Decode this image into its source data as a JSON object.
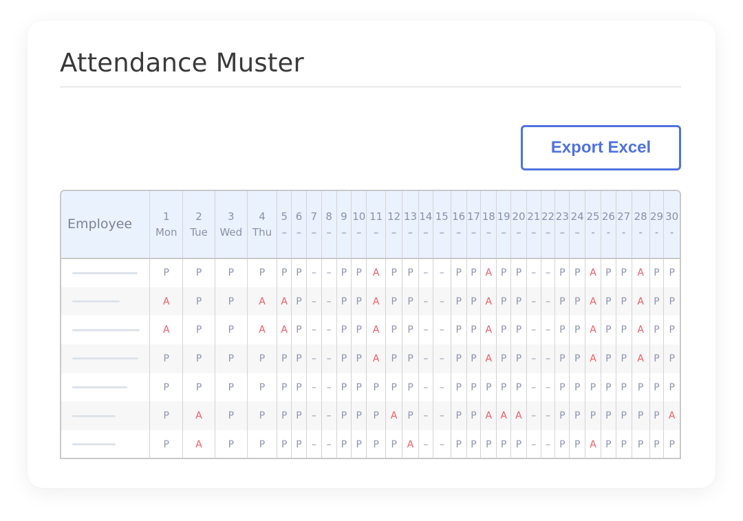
{
  "page": {
    "title": "Attendance Muster",
    "export_button_label": "Export Excel"
  },
  "colors": {
    "accent": "#4f72e0",
    "absent": "#f05a64",
    "present": "#8e94b0",
    "header_bg": "#eaf2fe"
  },
  "table": {
    "employee_header": "Employee",
    "columns": [
      {
        "day": "1",
        "weekday": "Mon"
      },
      {
        "day": "2",
        "weekday": "Tue"
      },
      {
        "day": "3",
        "weekday": "Wed"
      },
      {
        "day": "4",
        "weekday": "Thu"
      },
      {
        "day": "5",
        "weekday": "–"
      },
      {
        "day": "6",
        "weekday": "–"
      },
      {
        "day": "7",
        "weekday": "–"
      },
      {
        "day": "8",
        "weekday": "–"
      },
      {
        "day": "9",
        "weekday": "–"
      },
      {
        "day": "10",
        "weekday": "–"
      },
      {
        "day": "11",
        "weekday": "–"
      },
      {
        "day": "12",
        "weekday": "–"
      },
      {
        "day": "13",
        "weekday": "–"
      },
      {
        "day": "14",
        "weekday": "–"
      },
      {
        "day": "15",
        "weekday": "–"
      },
      {
        "day": "16",
        "weekday": "–"
      },
      {
        "day": "17",
        "weekday": "–"
      },
      {
        "day": "18",
        "weekday": "–"
      },
      {
        "day": "19",
        "weekday": "–"
      },
      {
        "day": "20",
        "weekday": "–"
      },
      {
        "day": "21",
        "weekday": "–"
      },
      {
        "day": "22",
        "weekday": "–"
      },
      {
        "day": "23",
        "weekday": "–"
      },
      {
        "day": "24",
        "weekday": "–"
      },
      {
        "day": "25",
        "weekday": "-"
      },
      {
        "day": "26",
        "weekday": "-"
      },
      {
        "day": "27",
        "weekday": "-"
      },
      {
        "day": "28",
        "weekday": "-"
      },
      {
        "day": "29",
        "weekday": "-"
      },
      {
        "day": "30",
        "weekday": "-"
      }
    ],
    "rows": [
      {
        "employee": "",
        "marks": [
          "P",
          "P",
          "P",
          "P",
          "P",
          "P",
          "–",
          "–",
          "P",
          "P",
          "A",
          "P",
          "P",
          "–",
          "–",
          "P",
          "P",
          "A",
          "P",
          "P",
          "–",
          "–",
          "P",
          "P",
          "A",
          "P",
          "P",
          "A",
          "P",
          "P"
        ]
      },
      {
        "employee": "",
        "marks": [
          "A",
          "P",
          "P",
          "A",
          "A",
          "P",
          "–",
          "–",
          "P",
          "P",
          "A",
          "P",
          "P",
          "–",
          "–",
          "P",
          "P",
          "A",
          "P",
          "P",
          "–",
          "–",
          "P",
          "P",
          "A",
          "P",
          "P",
          "A",
          "P",
          "P"
        ]
      },
      {
        "employee": "",
        "marks": [
          "A",
          "P",
          "P",
          "A",
          "A",
          "P",
          "–",
          "–",
          "P",
          "P",
          "A",
          "P",
          "P",
          "–",
          "–",
          "P",
          "P",
          "A",
          "P",
          "P",
          "–",
          "–",
          "P",
          "P",
          "A",
          "P",
          "P",
          "A",
          "P",
          "P"
        ]
      },
      {
        "employee": "",
        "marks": [
          "P",
          "P",
          "P",
          "P",
          "P",
          "P",
          "–",
          "–",
          "P",
          "P",
          "A",
          "P",
          "P",
          "–",
          "–",
          "P",
          "P",
          "A",
          "P",
          "P",
          "–",
          "–",
          "P",
          "P",
          "A",
          "P",
          "P",
          "A",
          "P",
          "P"
        ]
      },
      {
        "employee": "",
        "marks": [
          "P",
          "P",
          "P",
          "P",
          "P",
          "P",
          "–",
          "–",
          "P",
          "P",
          "P",
          "P",
          "P",
          "–",
          "–",
          "P",
          "P",
          "P",
          "P",
          "P",
          "–",
          "–",
          "P",
          "P",
          "P",
          "P",
          "P",
          "P",
          "P",
          "P"
        ]
      },
      {
        "employee": "",
        "marks": [
          "P",
          "A",
          "P",
          "P",
          "P",
          "P",
          "–",
          "–",
          "P",
          "P",
          "P",
          "A",
          "P",
          "–",
          "–",
          "P",
          "P",
          "A",
          "A",
          "A",
          "–",
          "–",
          "P",
          "P",
          "P",
          "P",
          "P",
          "P",
          "P",
          "A"
        ]
      },
      {
        "employee": "",
        "marks": [
          "P",
          "A",
          "P",
          "P",
          "P",
          "P",
          "–",
          "–",
          "P",
          "P",
          "P",
          "P",
          "A",
          "–",
          "–",
          "P",
          "P",
          "P",
          "P",
          "P",
          "–",
          "–",
          "P",
          "P",
          "A",
          "P",
          "P",
          "P",
          "P",
          "P"
        ]
      }
    ]
  }
}
